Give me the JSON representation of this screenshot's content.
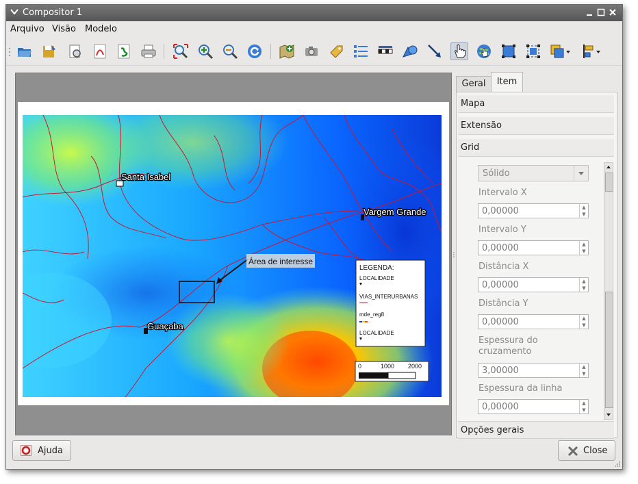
{
  "window": {
    "title": "Compositor 1"
  },
  "menu": [
    "Arquivo",
    "Visão",
    "Modelo"
  ],
  "toolbar": {
    "icons": [
      "open-icon",
      "save-icon",
      "print-preview-icon",
      "pdf-icon",
      "svg-icon",
      "print-icon",
      "zoom-full-icon",
      "zoom-in-icon",
      "zoom-out-icon",
      "refresh-icon",
      "add-map-icon",
      "add-image-icon",
      "add-label-icon",
      "add-legend-icon",
      "add-scalebar-icon",
      "add-shape-icon",
      "add-arrow-icon",
      "select-move-icon",
      "move-content-icon",
      "group-icon",
      "ungroup-icon",
      "raise-icon",
      "align-icon"
    ]
  },
  "map": {
    "labels": {
      "santa_isabel": "Santa Isabel",
      "vargem_grande": "Vargem Grande",
      "guecaba": "Guaçaba",
      "area_interesse": "Área de interesse"
    },
    "legend": {
      "title": "LEGENDA:",
      "items": [
        "LOCALIDADE",
        "VIAS_INTERURBANAS",
        "mde_reg8",
        "LOCALIDADE"
      ]
    },
    "scalebar": {
      "ticks": [
        "0",
        "1000",
        "2000"
      ]
    }
  },
  "panel": {
    "tabs": [
      "Geral",
      "Item"
    ],
    "sections": {
      "mapa": "Mapa",
      "extensao": "Extensão",
      "grid": "Grid",
      "opcoes": "Opções gerais"
    },
    "grid": {
      "style_value": "Sólido",
      "fields": [
        {
          "label": "Intervalo X",
          "value": "0,00000"
        },
        {
          "label": "Intervalo Y",
          "value": "0,00000"
        },
        {
          "label": "Distância X",
          "value": "0,00000"
        },
        {
          "label": "Distância Y",
          "value": "0,00000"
        },
        {
          "label": "Espessura do\ncruzamento",
          "value": "3,00000"
        },
        {
          "label": "Espessura da linha",
          "value": "0,00000"
        }
      ]
    }
  },
  "buttons": {
    "help": "Ajuda",
    "close": "Close"
  },
  "colors": {
    "titlebar": "#666666",
    "window_bg": "#e9e8e6",
    "road": "#d0182b",
    "map_blue": "#0a5cff"
  }
}
